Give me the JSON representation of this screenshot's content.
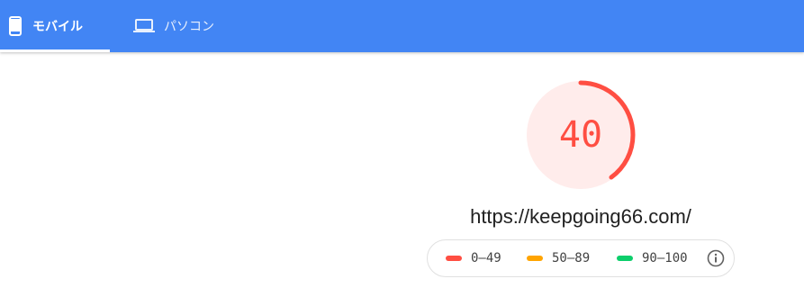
{
  "tabs": {
    "mobile": {
      "label": "モバイル",
      "icon": "smartphone-icon",
      "active": true
    },
    "desktop": {
      "label": "パソコン",
      "icon": "laptop-icon",
      "active": false
    }
  },
  "colors": {
    "header_bg": "#4285f4",
    "fail": "#ff4e42",
    "fail_bg": "#ffeceb",
    "average": "#ffa400",
    "pass": "#0cce6b"
  },
  "score": {
    "value": "40",
    "fraction": 0.4
  },
  "url": "https://keepgoing66.com/",
  "legend": {
    "fail": "0–49",
    "average": "50–89",
    "pass": "90–100",
    "info_icon": "info-icon"
  }
}
